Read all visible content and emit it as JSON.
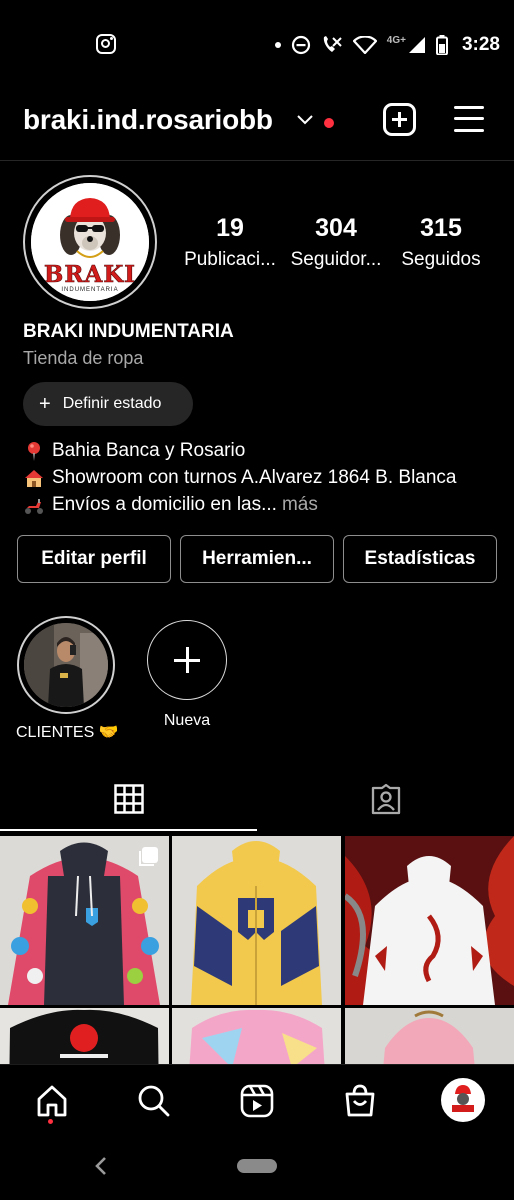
{
  "status_bar": {
    "network": "4G+",
    "time": "3:28"
  },
  "header": {
    "username": "braki.ind.rosariobb"
  },
  "profile": {
    "logo_text": "BRAKI",
    "logo_subtext": "INDUMENTARIA",
    "stats": [
      {
        "value": "19",
        "label": "Publicaci..."
      },
      {
        "value": "304",
        "label": "Seguidor..."
      },
      {
        "value": "315",
        "label": "Seguidos"
      }
    ],
    "name": "BRAKI INDUMENTARIA",
    "category": "Tienda de ropa",
    "status_button": "Definir estado",
    "bio": [
      "Bahia Banca y Rosario",
      "Showroom con turnos A.Alvarez 1864 B. Blanca",
      "Envíos a domicilio en las..."
    ],
    "bio_more": "más"
  },
  "actions": {
    "edit": "Editar perfil",
    "tools": "Herramien...",
    "stats": "Estadísticas"
  },
  "highlights": [
    {
      "label": "CLIENTES 🤝"
    },
    {
      "label": "Nueva"
    }
  ],
  "icons": {
    "status_bar": [
      "instagram-icon",
      "dnd-icon",
      "wifi-calling-icon",
      "wifi-icon",
      "signal-icon",
      "battery-icon"
    ],
    "header": [
      "chevron-down-icon",
      "new-post-icon",
      "menu-icon"
    ],
    "tabs": [
      "grid-icon",
      "tagged-icon"
    ],
    "bottom_nav": [
      "home-icon",
      "search-icon",
      "reels-icon",
      "shop-icon",
      "profile-avatar"
    ]
  },
  "colors": {
    "background": "#000000",
    "notification_dot": "#ff3040",
    "secondary_text": "#a8a8a8",
    "button_border": "#8e8e8e",
    "pill_background": "#262626"
  }
}
